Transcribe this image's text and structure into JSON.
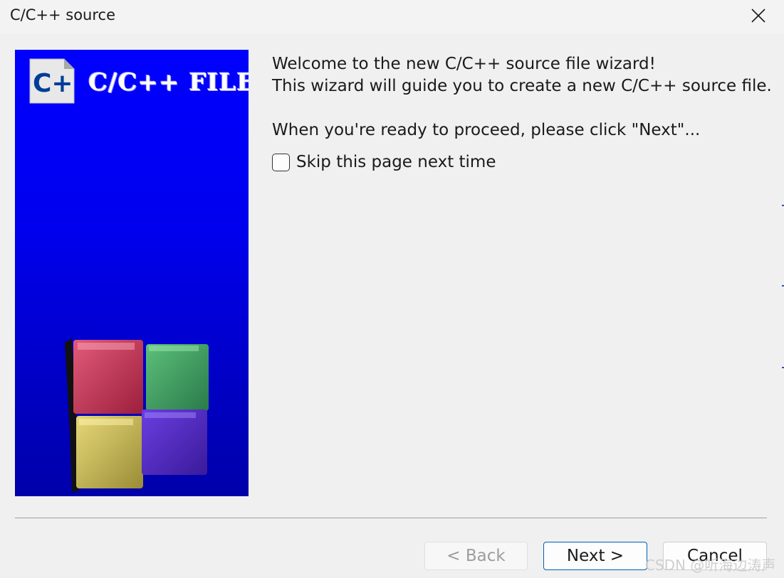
{
  "window": {
    "title": "C/C++ source",
    "close_icon": "close-icon"
  },
  "banner": {
    "title": "C/C++ FILE",
    "logo_text": "C++",
    "background_color": "#0000ff"
  },
  "content": {
    "line1": "Welcome to the new C/C++ source file wizard!",
    "line2": "This wizard will guide you to create a new C/C++ source file.",
    "line3": "When you're ready to proceed, please click \"Next\"...",
    "skip_label": "Skip this page next time",
    "skip_checked": false
  },
  "buttons": {
    "back": "< Back",
    "next": "Next >",
    "cancel": "Cancel"
  },
  "watermark": "CSDN @听海边涛声",
  "colors": {
    "accent": "#005fb8"
  }
}
